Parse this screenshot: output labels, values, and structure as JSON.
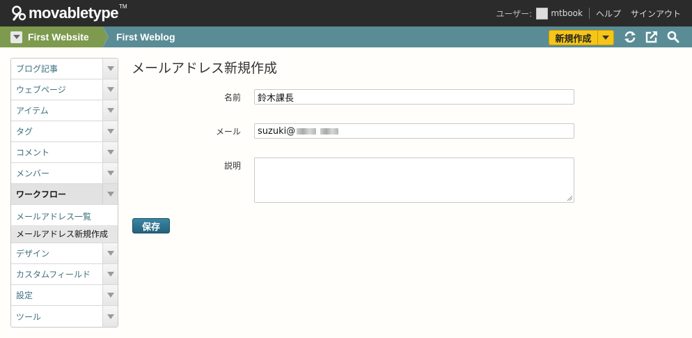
{
  "header": {
    "logo_text": "movabletype",
    "logo_tm": "TM",
    "user_label": "ユーザー:",
    "user_name": "mtbook",
    "help_label": "ヘルプ",
    "signout_label": "サインアウト"
  },
  "nav": {
    "website": "First Website",
    "blog": "First Weblog",
    "new_button": "新規作成"
  },
  "sidebar": {
    "items": [
      {
        "label": "ブログ記事"
      },
      {
        "label": "ウェブページ"
      },
      {
        "label": "アイテム"
      },
      {
        "label": "タグ"
      },
      {
        "label": "コメント"
      },
      {
        "label": "メンバー"
      },
      {
        "label": "ワークフロー"
      }
    ],
    "sub_items": [
      {
        "label": "メールアドレス一覧"
      },
      {
        "label": "メールアドレス新規作成"
      }
    ],
    "items_after": [
      {
        "label": "デザイン"
      },
      {
        "label": "カスタムフィールド"
      },
      {
        "label": "設定"
      },
      {
        "label": "ツール"
      }
    ]
  },
  "main": {
    "title": "メールアドレス新規作成",
    "name_label": "名前",
    "name_value": "鈴木課長",
    "mail_label": "メール",
    "mail_value": "suzuki@",
    "desc_label": "説明",
    "desc_value": "",
    "save_label": "保存"
  },
  "colors": {
    "header_bg": "#2b2b2b",
    "nav_bg": "#5a8c96",
    "website_crumb_bg": "#7d9a4e",
    "new_button_bg": "#f5c518",
    "save_button_bg": "#2a6f8a",
    "link": "#3b6e7e"
  }
}
